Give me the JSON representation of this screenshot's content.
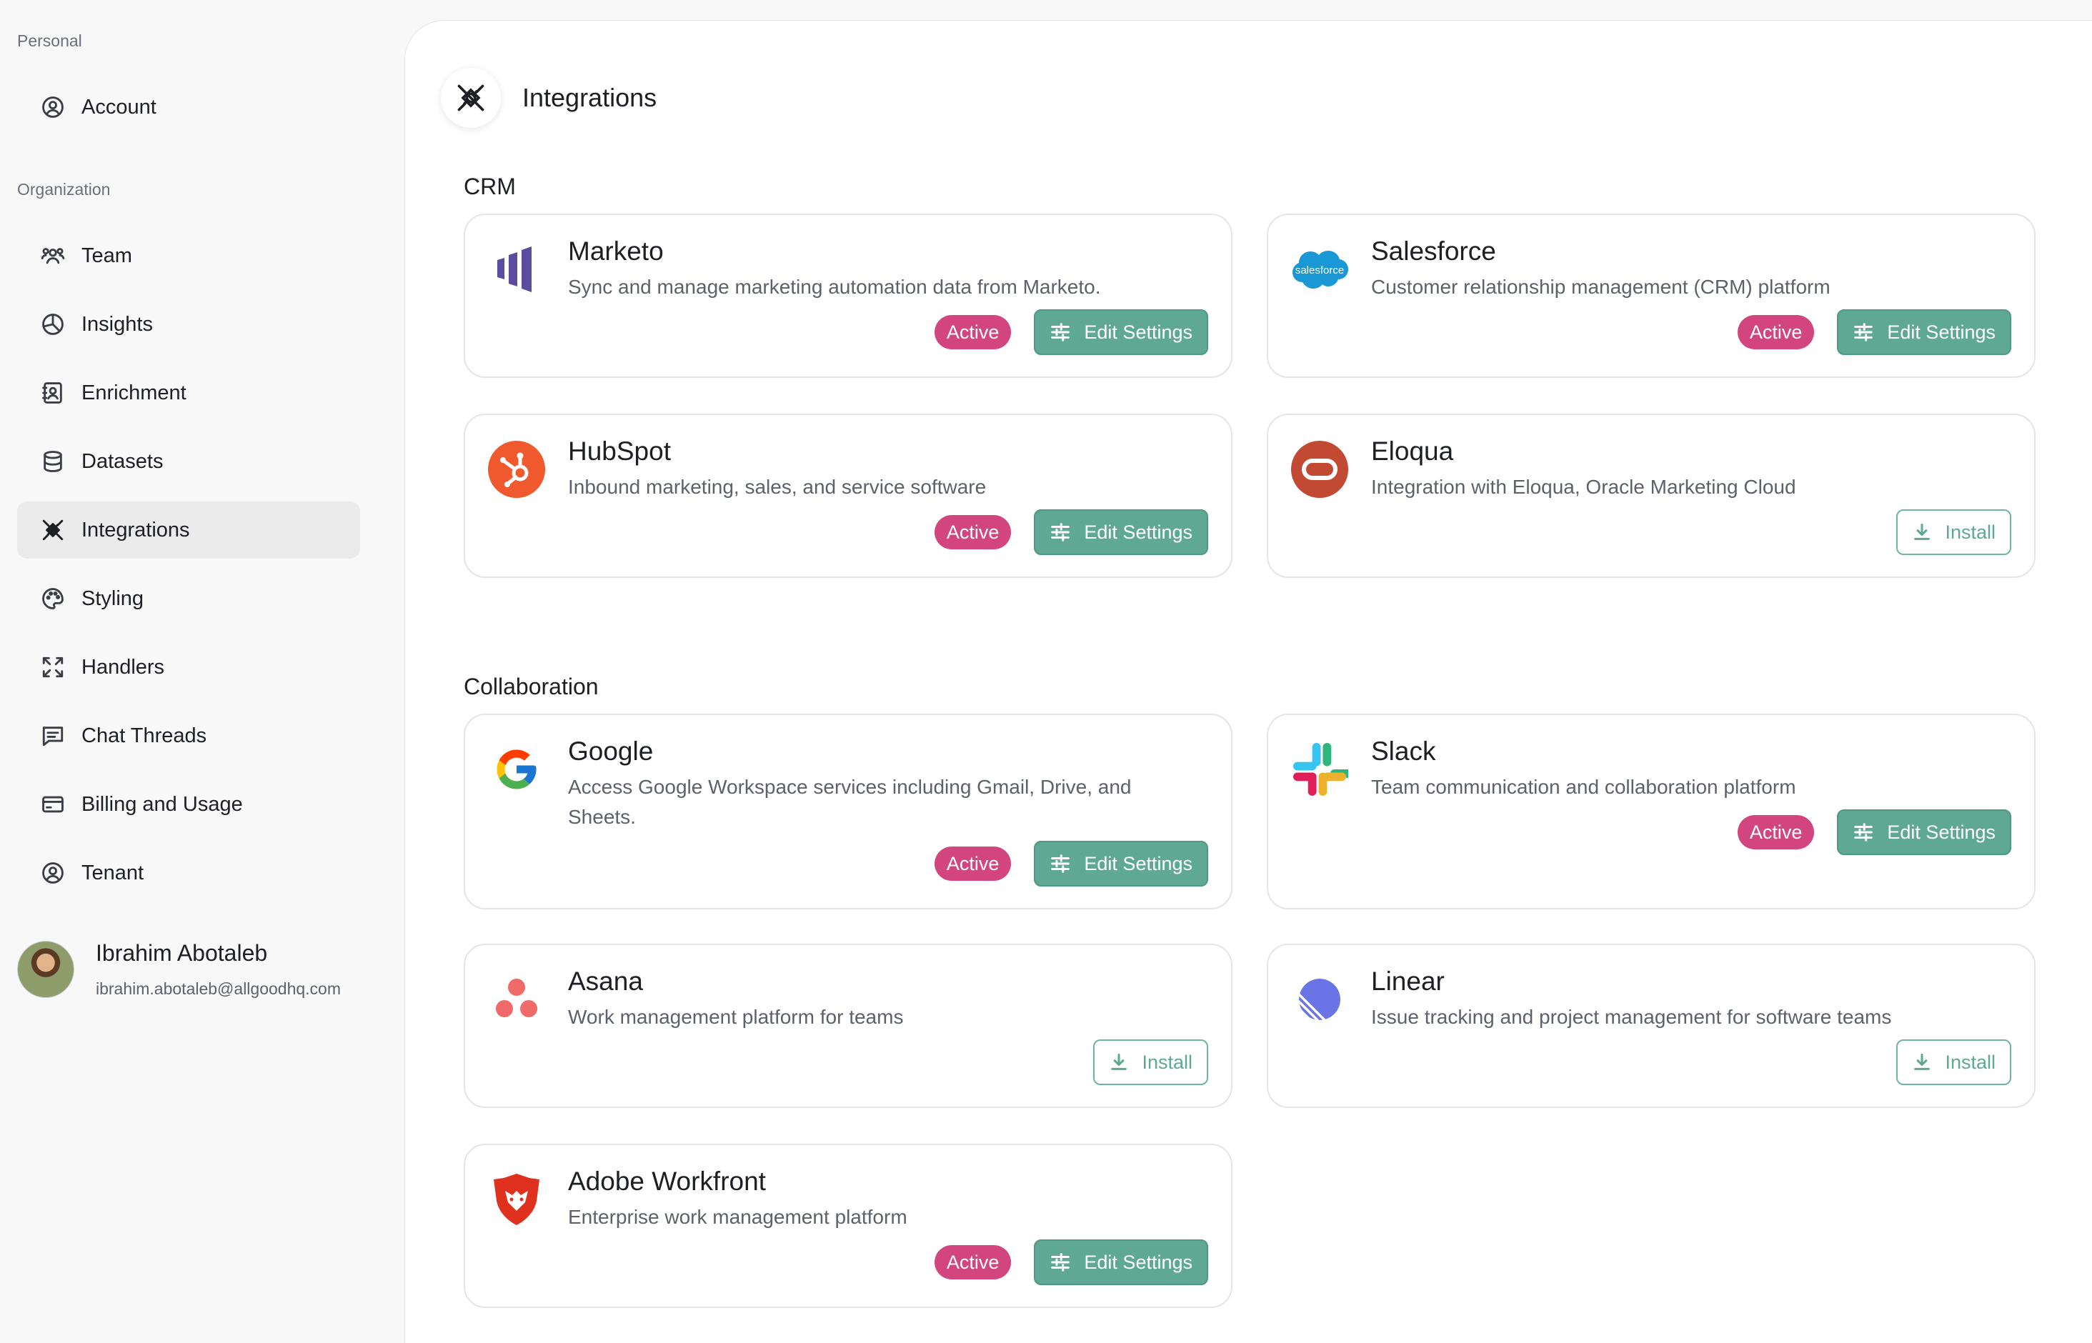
{
  "sidebar": {
    "personal_label": "Personal",
    "organization_label": "Organization",
    "account": "Account",
    "items": [
      {
        "label": "Team"
      },
      {
        "label": "Insights"
      },
      {
        "label": "Enrichment"
      },
      {
        "label": "Datasets"
      },
      {
        "label": "Integrations"
      },
      {
        "label": "Styling"
      },
      {
        "label": "Handlers"
      },
      {
        "label": "Chat Threads"
      },
      {
        "label": "Billing and Usage"
      },
      {
        "label": "Tenant"
      }
    ],
    "active_item": "Integrations",
    "user": {
      "name": "Ibrahim Abotaleb",
      "email": "ibrahim.abotaleb@allgoodhq.com"
    }
  },
  "page": {
    "title": "Integrations"
  },
  "labels": {
    "active": "Active",
    "edit_settings": "Edit Settings",
    "install": "Install"
  },
  "groups": [
    {
      "title": "CRM",
      "integrations": [
        {
          "name": "Marketo",
          "description": "Sync and manage marketing automation data from Marketo.",
          "status": "active"
        },
        {
          "name": "Salesforce",
          "description": "Customer relationship management (CRM) platform",
          "status": "active",
          "logo_text": "salesforce"
        },
        {
          "name": "HubSpot",
          "description": "Inbound marketing, sales, and service software",
          "status": "active"
        },
        {
          "name": "Eloqua",
          "description": "Integration with Eloqua, Oracle Marketing Cloud",
          "status": "not_installed"
        }
      ]
    },
    {
      "title": "Collaboration",
      "integrations": [
        {
          "name": "Google",
          "description": "Access Google Workspace services including Gmail, Drive, and Sheets.",
          "status": "active"
        },
        {
          "name": "Slack",
          "description": "Team communication and collaboration platform",
          "status": "active"
        },
        {
          "name": "Asana",
          "description": "Work management platform for teams",
          "status": "not_installed"
        },
        {
          "name": "Linear",
          "description": "Issue tracking and project management for software teams",
          "status": "not_installed"
        },
        {
          "name": "Adobe Workfront",
          "description": "Enterprise work management platform",
          "status": "active"
        }
      ]
    }
  ],
  "colors": {
    "active_badge": "#d2457f",
    "edit_button": "#5ea894",
    "install_border": "#6eb5a1",
    "sidebar_active": "#ebebec"
  }
}
